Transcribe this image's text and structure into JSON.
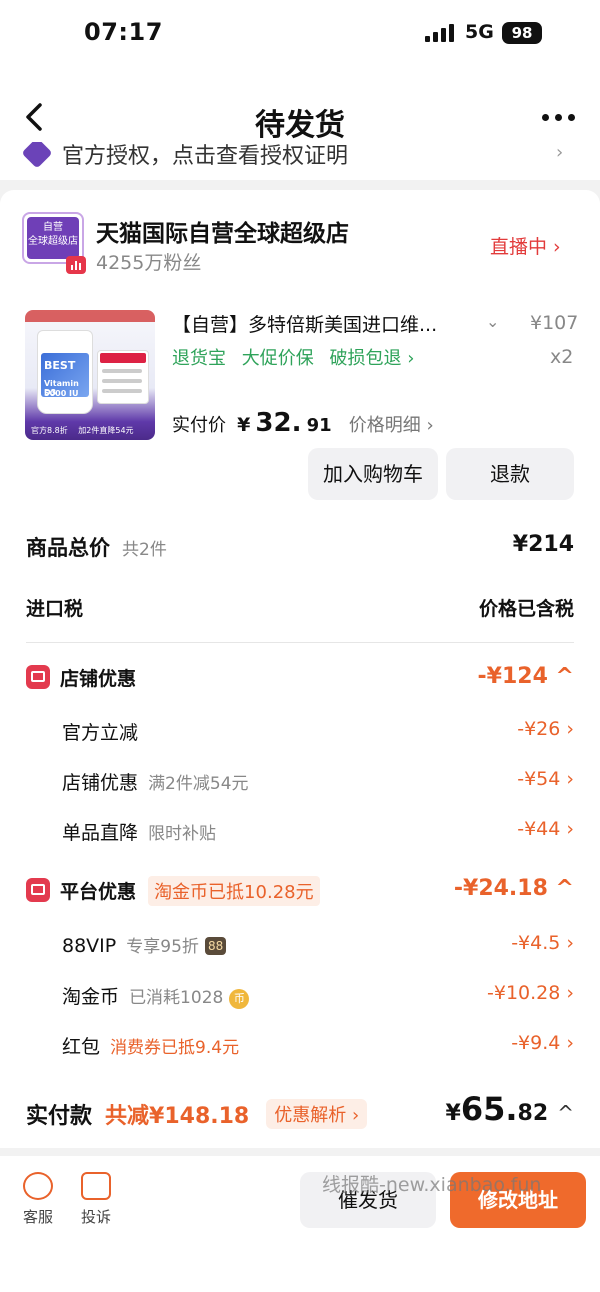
{
  "status_bar": {
    "time": "07:17",
    "network": "5G",
    "battery": "98"
  },
  "nav": {
    "title": "待发货"
  },
  "notice": {
    "text": "官方授权，点击查看授权证明"
  },
  "store": {
    "logo_text_top": "自营",
    "logo_text_bottom": "全球超级店",
    "name": "天猫国际自营全球超级店",
    "fans": "4255万粉丝",
    "live_label": "直播中 ›"
  },
  "product": {
    "title": "【自营】多特倍斯美国进口维...",
    "price": "¥107",
    "quantity": "x2",
    "services": [
      "退货宝",
      "大促价保",
      "破损包退 ›"
    ],
    "paid_label": "实付价",
    "paid_yen": "¥",
    "paid_int": "32.",
    "paid_dec": "91",
    "price_detail": "价格明细 ›",
    "image_text": {
      "brand": "BEST",
      "name": "Vitamin D3",
      "dose": "5000 IU",
      "footer": "官方8.8折 　加2件直降54元"
    },
    "buttons": {
      "cart": "加入购物车",
      "refund": "退款"
    }
  },
  "summary": {
    "total_label": "商品总价",
    "total_count": "共2件",
    "total_value": "¥214",
    "tax_label": "进口税",
    "tax_value": "价格已含税",
    "store_discount": {
      "label": "店铺优惠",
      "value": "-¥124 ^",
      "items": [
        {
          "label": "官方立减",
          "note": "",
          "value": "-¥26 ›"
        },
        {
          "label": "店铺优惠",
          "note": "满2件减54元",
          "value": "-¥54 ›"
        },
        {
          "label": "单品直降",
          "note": "限时补贴",
          "value": "-¥44 ›"
        }
      ]
    },
    "platform_discount": {
      "label": "平台优惠",
      "tag": "淘金币已抵10.28元",
      "value": "-¥24.18 ^",
      "items": [
        {
          "label": "88VIP",
          "note": "专享95折",
          "badge": "88",
          "value": "-¥4.5 ›"
        },
        {
          "label": "淘金币",
          "note": "已消耗1028",
          "badge": "币",
          "value": "-¥10.28 ›"
        },
        {
          "label": "红包",
          "note": "消费券已抵9.4元",
          "value": "-¥9.4 ›"
        }
      ]
    },
    "final": {
      "label": "实付款",
      "saved": "共减¥148.18",
      "analysis": "优惠解析 ›",
      "yen": "¥",
      "int": "65.",
      "dec": "82",
      "caret": "^"
    }
  },
  "bottom": {
    "service_label": "客服",
    "complaint_label": "投诉",
    "urge_button": "催发货",
    "modify_button": "修改地址"
  },
  "watermark": "线报酷-new.xianbao.fun",
  "colors": {
    "accent": "#ef6a2c",
    "discount": "#e9622b",
    "service_green": "#2fa35a",
    "live_red": "#e23b3b"
  }
}
